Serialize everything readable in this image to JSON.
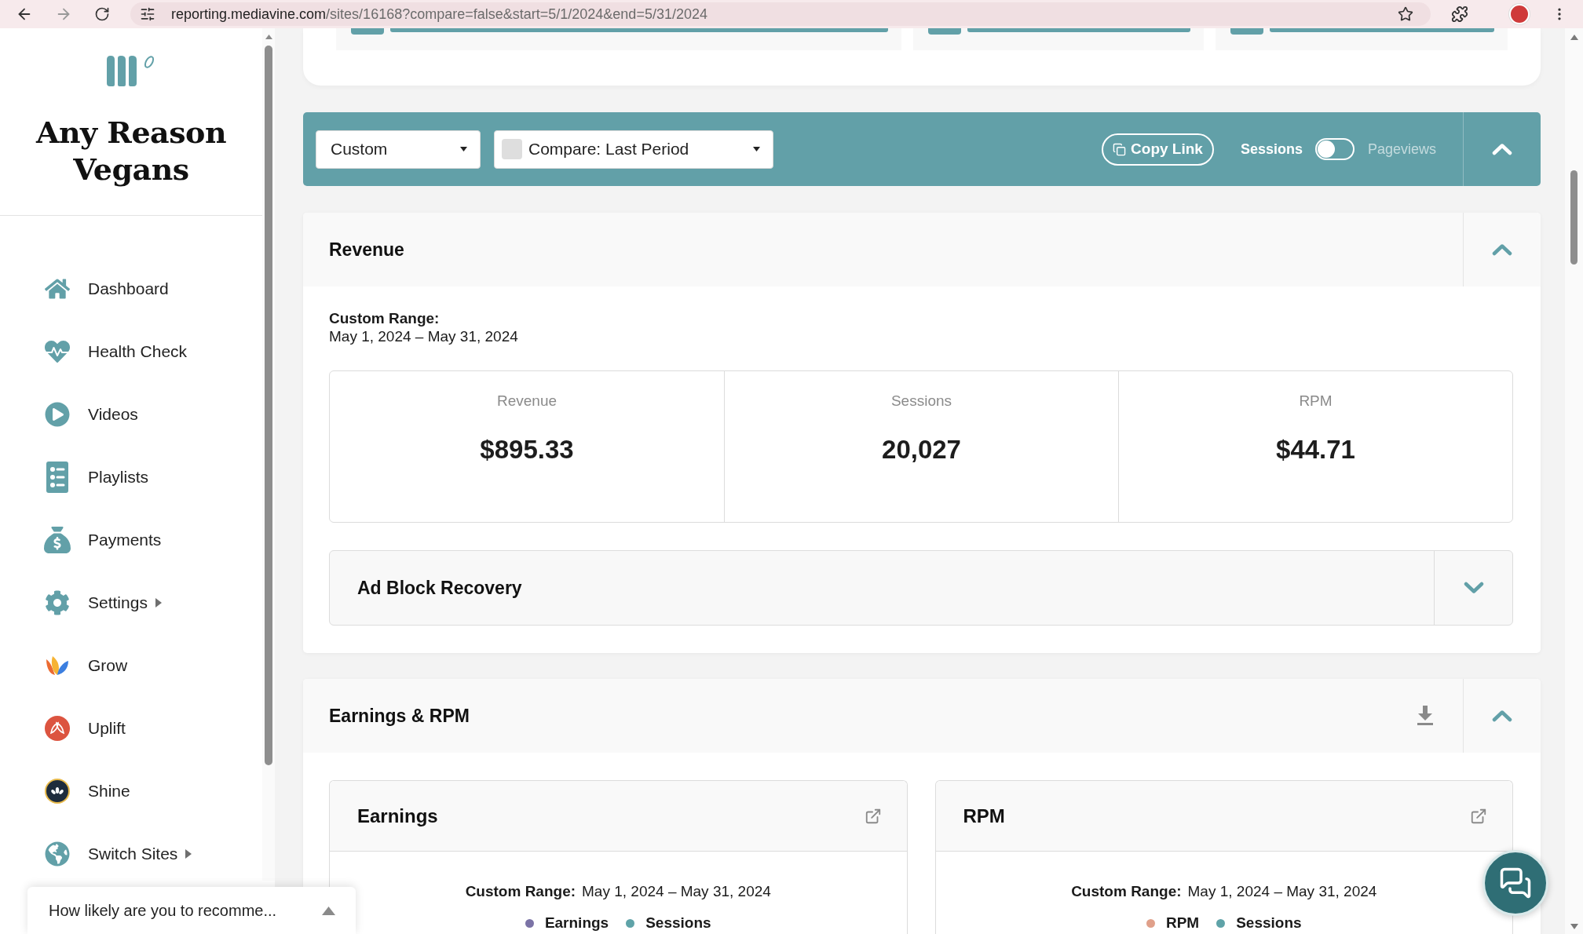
{
  "browser": {
    "url_host": "reporting.mediavine.com",
    "url_path": "/sites/16168?compare=false&start=5/1/2024&end=5/31/2024"
  },
  "sidebar": {
    "site_name": "Any Reason Vegans",
    "items": [
      {
        "label": "Dashboard",
        "submenu": false
      },
      {
        "label": "Health Check",
        "submenu": false
      },
      {
        "label": "Videos",
        "submenu": false
      },
      {
        "label": "Playlists",
        "submenu": false
      },
      {
        "label": "Payments",
        "submenu": false
      },
      {
        "label": "Settings",
        "submenu": true
      },
      {
        "label": "Grow",
        "submenu": false
      },
      {
        "label": "Uplift",
        "submenu": false
      },
      {
        "label": "Shine",
        "submenu": false
      },
      {
        "label": "Switch Sites",
        "submenu": true
      }
    ]
  },
  "toolbar": {
    "range_select": {
      "value": "Custom"
    },
    "compare_select": {
      "checked": false,
      "value": "Compare: Last Period"
    },
    "copy_link": "Copy Link",
    "metric_toggle": {
      "left_label": "Sessions",
      "right_label": "Pageviews",
      "on": false
    },
    "expanded": true
  },
  "revenue": {
    "title": "Revenue",
    "expanded": true,
    "range_label": "Custom Range:",
    "range": "May 1, 2024 – May 31, 2024",
    "stats": [
      {
        "label": "Revenue",
        "value": "$895.33"
      },
      {
        "label": "Sessions",
        "value": "20,027"
      },
      {
        "label": "RPM",
        "value": "$44.71"
      }
    ],
    "ad_block": {
      "title": "Ad Block Recovery",
      "expanded": false
    }
  },
  "earnings": {
    "title": "Earnings & RPM",
    "expanded": true,
    "charts": [
      {
        "title": "Earnings",
        "range_label": "Custom Range:",
        "range": "May 1, 2024 – May 31, 2024",
        "legend": [
          {
            "label": "Earnings",
            "color": "#7b73a6"
          },
          {
            "label": "Sessions",
            "color": "#5fa3a8"
          }
        ]
      },
      {
        "title": "RPM",
        "range_label": "Custom Range:",
        "range": "May 1, 2024 – May 31, 2024",
        "legend": [
          {
            "label": "RPM",
            "color": "#e0a08a"
          },
          {
            "label": "Sessions",
            "color": "#5fa3a8"
          }
        ]
      }
    ]
  },
  "survey": {
    "text": "How likely are you to recomme..."
  }
}
